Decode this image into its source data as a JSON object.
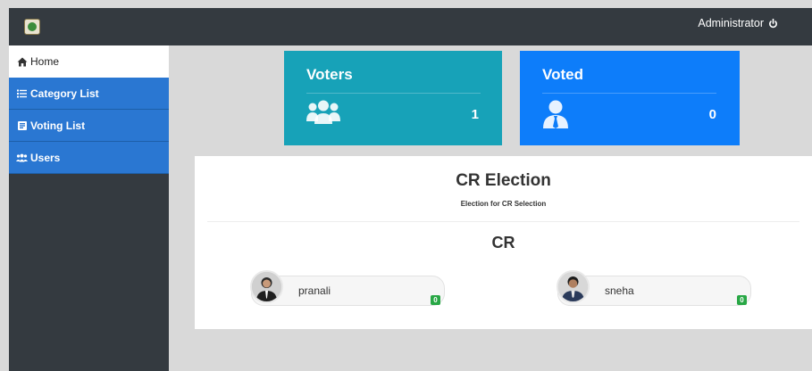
{
  "topbar": {
    "user_label": "Administrator"
  },
  "sidebar": {
    "items": [
      {
        "label": "Home",
        "icon": "home-icon"
      },
      {
        "label": "Category List",
        "icon": "list-icon"
      },
      {
        "label": "Voting List",
        "icon": "ballot-icon"
      },
      {
        "label": "Users",
        "icon": "users-icon"
      }
    ]
  },
  "cards": {
    "voters": {
      "title": "Voters",
      "count": "1",
      "icon": "users-icon",
      "color": "#17a2b8"
    },
    "voted": {
      "title": "Voted",
      "count": "0",
      "icon": "user-tie-icon",
      "color": "#0d7dfa"
    }
  },
  "election": {
    "title": "CR Election",
    "subtitle": "Election for CR Selection",
    "position": "CR",
    "candidates": [
      {
        "name": "pranali",
        "votes": "0"
      },
      {
        "name": "sneha",
        "votes": "0"
      }
    ]
  },
  "colors": {
    "nav_bg": "#343a40",
    "nav_item": "#2a77d2",
    "badge": "#28a745"
  }
}
